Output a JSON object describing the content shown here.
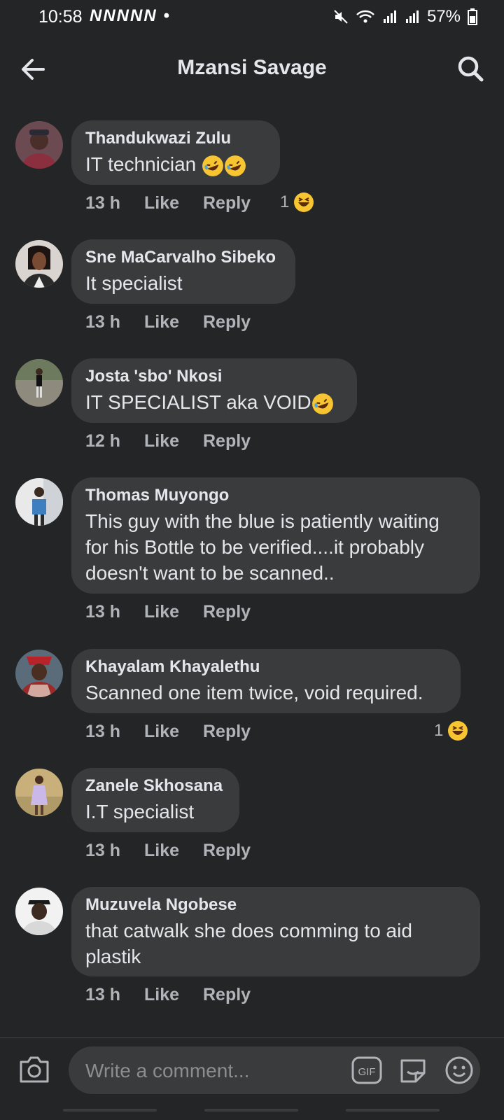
{
  "status_bar": {
    "time": "10:58",
    "notification_icons": "NNNNN •",
    "battery": "57%"
  },
  "header": {
    "title": "Mzansi Savage"
  },
  "comments": [
    {
      "author": "Thandukwazi Zulu",
      "text": "IT technician",
      "time": "13 h",
      "like": "Like",
      "reply": "Reply",
      "reaction_count": "1",
      "text_emoji_count": 2
    },
    {
      "author": "Sne MaCarvalho Sibeko",
      "text": "It specialist",
      "time": "13 h",
      "like": "Like",
      "reply": "Reply"
    },
    {
      "author": "Josta 'sbo' Nkosi",
      "text": "IT SPECIALIST aka VOID",
      "time": "12 h",
      "like": "Like",
      "reply": "Reply",
      "text_emoji_count": 1
    },
    {
      "author": "Thomas Muyongo",
      "text_lines": [
        "This guy with the blue is patiently waiting",
        "for his Bottle to be verified....it probably",
        "doesn't want to be scanned.."
      ],
      "time": "13 h",
      "like": "Like",
      "reply": "Reply"
    },
    {
      "author": "Khayalam Khayalethu",
      "text": "Scanned one item twice, void required.",
      "time": "13 h",
      "like": "Like",
      "reply": "Reply",
      "reaction_count": "1"
    },
    {
      "author": "Zanele Skhosana",
      "text": "I.T specialist",
      "time": "13 h",
      "like": "Like",
      "reply": "Reply"
    },
    {
      "author": "Muzuvela Ngobese",
      "text_lines": [
        "that catwalk she does comming to aid",
        "plastik"
      ],
      "time": "13 h",
      "like": "Like",
      "reply": "Reply"
    }
  ],
  "composer": {
    "placeholder": "Write a comment...",
    "gif_label": "GIF"
  },
  "colors": {
    "background": "#242526",
    "bubble": "#3a3b3c",
    "text_primary": "#e4e6eb",
    "text_secondary": "#b0b3b8",
    "emoji_yellow": "#f7c531"
  }
}
